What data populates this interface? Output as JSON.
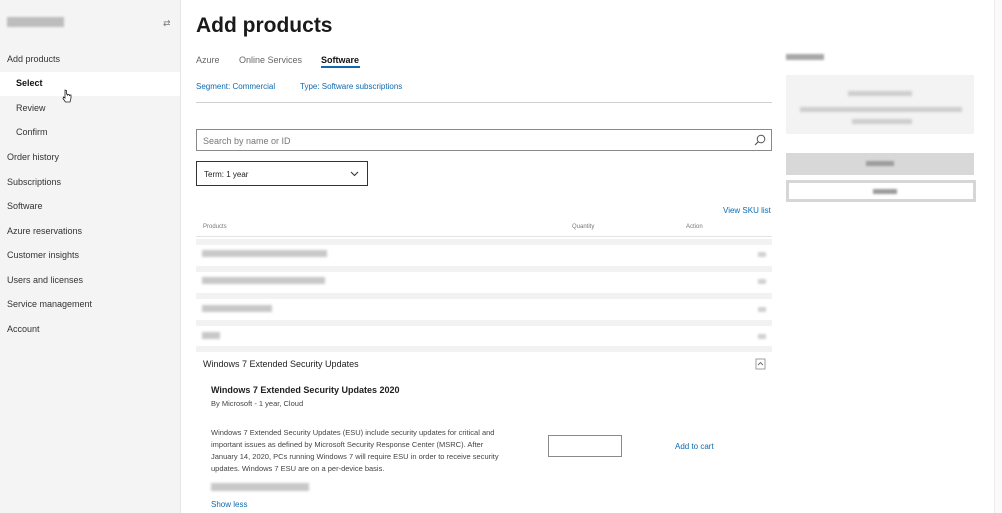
{
  "sidebar": {
    "items": [
      {
        "label": "Add products"
      },
      {
        "label": "Select"
      },
      {
        "label": "Review"
      },
      {
        "label": "Confirm"
      },
      {
        "label": "Order history"
      },
      {
        "label": "Subscriptions"
      },
      {
        "label": "Software"
      },
      {
        "label": "Azure reservations"
      },
      {
        "label": "Customer insights"
      },
      {
        "label": "Users and licenses"
      },
      {
        "label": "Service management"
      },
      {
        "label": "Account"
      }
    ],
    "selected_item": "Select"
  },
  "page": {
    "title": "Add products"
  },
  "tabs": [
    {
      "label": "Azure"
    },
    {
      "label": "Online Services"
    },
    {
      "label": "Software",
      "active": true
    }
  ],
  "filters": {
    "segment": "Segment: Commercial",
    "type": "Type: Software subscriptions"
  },
  "search": {
    "placeholder": "Search by name or ID",
    "value": ""
  },
  "term": {
    "selected": "Term: 1 year"
  },
  "view_sku_label": "View SKU list",
  "table": {
    "columns": [
      "Products",
      "Quantity",
      "Action"
    ]
  },
  "expanded": {
    "group_title": "Windows 7 Extended Security Updates",
    "product_name": "Windows 7 Extended Security Updates 2020",
    "meta": "By Microsoft - 1 year, Cloud",
    "description": "Windows 7 Extended Security Updates (ESU) include security updates for critical and important issues as defined by Microsoft Security Response Center (MSRC). After January 14, 2020, PCs running Windows 7 will require ESU in order to receive security updates. Windows 7 ESU are on a per-device basis.",
    "quantity": "",
    "add_to_cart": "Add to cart",
    "show_less": "Show less"
  },
  "colors": {
    "link": "#0d6ab0",
    "sidebar_bg": "#f4f4f4",
    "accent_underline": "#0d6ab0"
  },
  "icons": [
    "collapse-icon",
    "search-icon",
    "chevron-down-icon",
    "collapse-section-icon",
    "mouse-cursor-icon"
  ]
}
